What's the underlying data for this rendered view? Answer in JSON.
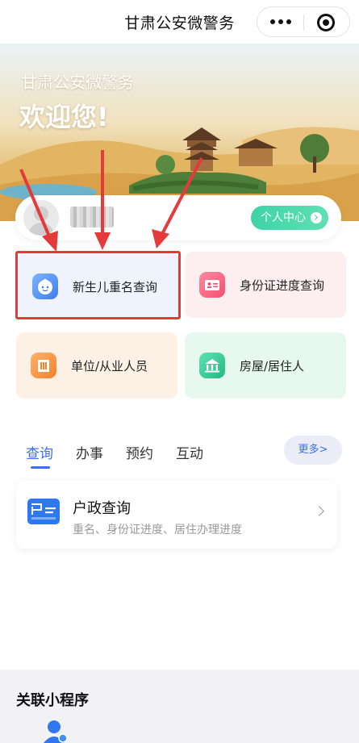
{
  "navbar": {
    "title": "甘肃公安微警务"
  },
  "banner": {
    "subtitle": "甘肃公安微警务",
    "welcome": "欢迎您!"
  },
  "user": {
    "center_label": "个人中心"
  },
  "services": [
    {
      "label": "新生儿重名查询",
      "icon": "baby-face-icon",
      "color": "#3f7df0"
    },
    {
      "label": "身份证进度查询",
      "icon": "id-card-icon",
      "color": "#f2506e"
    },
    {
      "label": "单位/从业人员",
      "icon": "building-icon",
      "color": "#f1812c"
    },
    {
      "label": "房屋/居住人",
      "icon": "house-icon",
      "color": "#21b885"
    }
  ],
  "tabs": [
    {
      "label": "查询",
      "active": true
    },
    {
      "label": "办事",
      "active": false
    },
    {
      "label": "预约",
      "active": false
    },
    {
      "label": "互动",
      "active": false
    }
  ],
  "more_label": "更多>",
  "card": {
    "title": "户政查询",
    "desc": "重名、身份证进度、居住办理进度",
    "icon": "household-register-icon"
  },
  "related": {
    "title": "关联小程序"
  },
  "colors": {
    "accent": "#3c6df0",
    "annotation": "#e53a3a",
    "user_center_btn": "#3fd3a3"
  }
}
